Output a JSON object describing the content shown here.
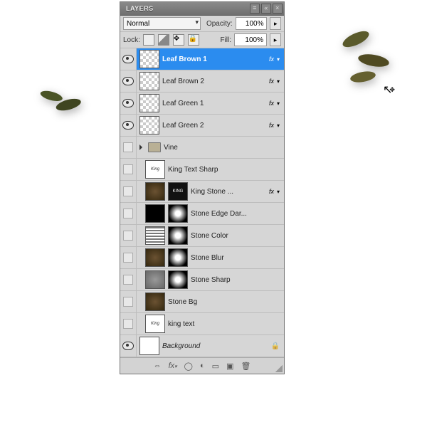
{
  "panel": {
    "title": "LAYERS",
    "blend_mode": "Normal",
    "opacity_label": "Opacity:",
    "opacity_value": "100%",
    "lock_label": "Lock:",
    "fill_label": "Fill:",
    "fill_value": "100%"
  },
  "layers": [
    {
      "visible": true,
      "name": "Leaf Brown 1",
      "selected": true,
      "fx": true,
      "thumbs": [
        "trans"
      ],
      "indent": 0
    },
    {
      "visible": true,
      "name": "Leaf Brown 2",
      "selected": false,
      "fx": true,
      "thumbs": [
        "trans"
      ],
      "indent": 0
    },
    {
      "visible": true,
      "name": "Leaf Green 1",
      "selected": false,
      "fx": true,
      "thumbs": [
        "trans"
      ],
      "indent": 0
    },
    {
      "visible": true,
      "name": "Leaf Green 2",
      "selected": false,
      "fx": true,
      "thumbs": [
        "trans"
      ],
      "indent": 0
    },
    {
      "visible": false,
      "name": "Vine",
      "selected": false,
      "fx": false,
      "group": true,
      "indent": 0
    },
    {
      "visible": false,
      "name": "King Text Sharp",
      "selected": false,
      "fx": false,
      "thumbs": [
        "kingw"
      ],
      "indent": 1
    },
    {
      "visible": false,
      "name": "King Stone ...",
      "selected": false,
      "fx": true,
      "thumbs": [
        "brown",
        "king"
      ],
      "indent": 1
    },
    {
      "visible": false,
      "name": "Stone Edge Dar...",
      "selected": false,
      "fx": false,
      "thumbs": [
        "black",
        "radial"
      ],
      "indent": 1
    },
    {
      "visible": false,
      "name": "Stone Color",
      "selected": false,
      "fx": false,
      "thumbs": [
        "stripes",
        "radial"
      ],
      "indent": 1
    },
    {
      "visible": false,
      "name": "Stone Blur",
      "selected": false,
      "fx": false,
      "thumbs": [
        "brown",
        "radial"
      ],
      "indent": 1
    },
    {
      "visible": false,
      "name": "Stone Sharp",
      "selected": false,
      "fx": false,
      "thumbs": [
        "noise",
        "radial"
      ],
      "indent": 1
    },
    {
      "visible": false,
      "name": "Stone Bg",
      "selected": false,
      "fx": false,
      "thumbs": [
        "brown"
      ],
      "indent": 1
    },
    {
      "visible": false,
      "name": "king text",
      "selected": false,
      "fx": false,
      "thumbs": [
        "kingw"
      ],
      "indent": 1
    },
    {
      "visible": true,
      "name": "Background",
      "selected": false,
      "fx": false,
      "thumbs": [
        "white"
      ],
      "italic": true,
      "locked": true,
      "indent": 0
    }
  ],
  "footer_icons": [
    "link-icon",
    "fx-icon",
    "mask-icon",
    "adjustment-icon",
    "group-icon",
    "new-layer-icon",
    "trash-icon"
  ],
  "cursor_label": "move-cursor"
}
